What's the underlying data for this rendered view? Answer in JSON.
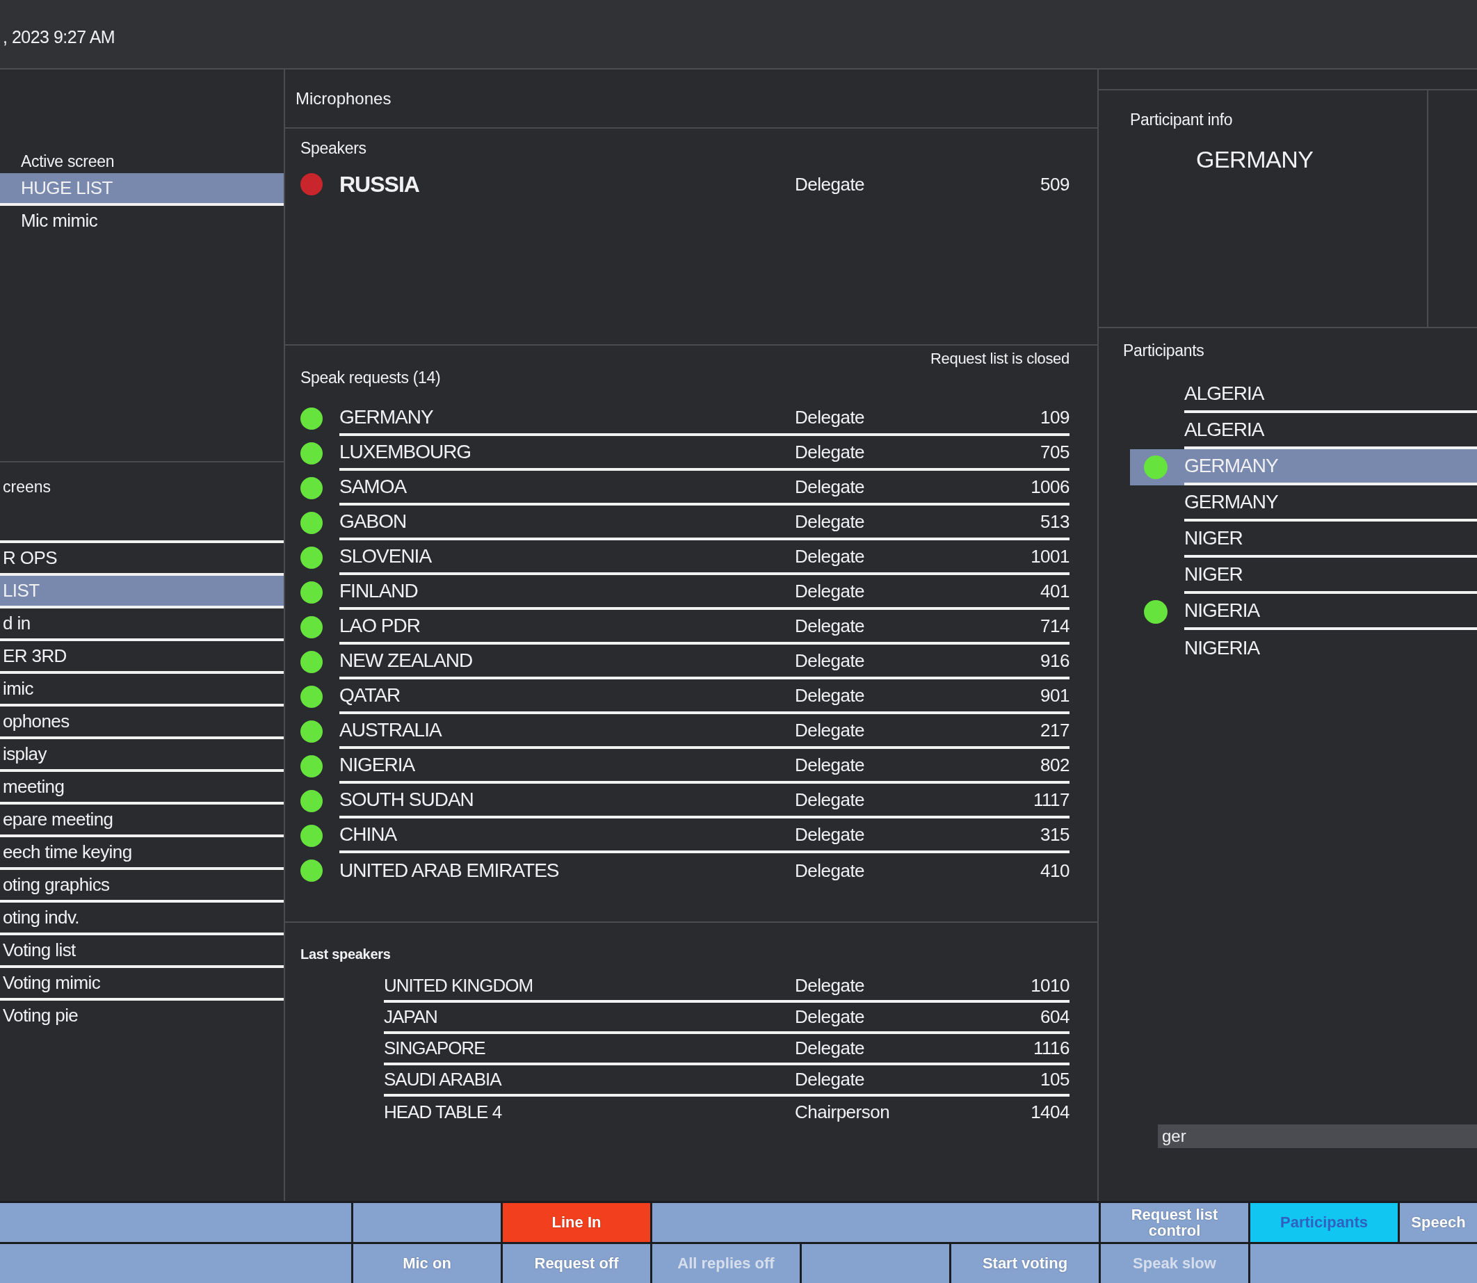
{
  "header": {
    "datetime": ", 2023 9:27 AM"
  },
  "active_screen": {
    "label": "Active screen",
    "items": [
      {
        "label": "HUGE LIST",
        "selected": true
      },
      {
        "label": "Mic mimic",
        "selected": false
      }
    ]
  },
  "screens": {
    "title": "creens",
    "items": [
      {
        "label": "R OPS",
        "selected": false
      },
      {
        "label": "LIST",
        "selected": true
      },
      {
        "label": "d in",
        "selected": false
      },
      {
        "label": "ER 3RD",
        "selected": false
      },
      {
        "label": "imic",
        "selected": false
      },
      {
        "label": "ophones",
        "selected": false
      },
      {
        "label": "isplay",
        "selected": false
      },
      {
        "label": "meeting",
        "selected": false
      },
      {
        "label": "epare meeting",
        "selected": false
      },
      {
        "label": "eech time keying",
        "selected": false
      },
      {
        "label": "oting graphics",
        "selected": false
      },
      {
        "label": "oting indv.",
        "selected": false
      },
      {
        "label": "Voting list",
        "selected": false
      },
      {
        "label": "Voting mimic",
        "selected": false
      },
      {
        "label": "Voting pie",
        "selected": false
      }
    ]
  },
  "microphones": {
    "title": "Microphones",
    "speakers": {
      "title": "Speakers",
      "rows": [
        {
          "name": "RUSSIA",
          "role": "Delegate",
          "number": "509"
        }
      ]
    },
    "speak_requests": {
      "title": "Speak requests (14)",
      "status": "Request list is closed",
      "rows": [
        {
          "name": "GERMANY",
          "role": "Delegate",
          "number": "109"
        },
        {
          "name": "LUXEMBOURG",
          "role": "Delegate",
          "number": "705"
        },
        {
          "name": "SAMOA",
          "role": "Delegate",
          "number": "1006"
        },
        {
          "name": "GABON",
          "role": "Delegate",
          "number": "513"
        },
        {
          "name": "SLOVENIA",
          "role": "Delegate",
          "number": "1001"
        },
        {
          "name": "FINLAND",
          "role": "Delegate",
          "number": "401"
        },
        {
          "name": "LAO PDR",
          "role": "Delegate",
          "number": "714"
        },
        {
          "name": "NEW ZEALAND",
          "role": "Delegate",
          "number": "916"
        },
        {
          "name": "QATAR",
          "role": "Delegate",
          "number": "901"
        },
        {
          "name": "AUSTRALIA",
          "role": "Delegate",
          "number": "217"
        },
        {
          "name": "NIGERIA",
          "role": "Delegate",
          "number": "802"
        },
        {
          "name": "SOUTH SUDAN",
          "role": "Delegate",
          "number": "1117"
        },
        {
          "name": "CHINA",
          "role": "Delegate",
          "number": "315"
        },
        {
          "name": "UNITED ARAB EMIRATES",
          "role": "Delegate",
          "number": "410"
        }
      ]
    },
    "last_speakers": {
      "title": "Last speakers",
      "rows": [
        {
          "name": "UNITED KINGDOM",
          "role": "Delegate",
          "number": "1010"
        },
        {
          "name": "JAPAN",
          "role": "Delegate",
          "number": "604"
        },
        {
          "name": "SINGAPORE",
          "role": "Delegate",
          "number": "1116"
        },
        {
          "name": "SAUDI ARABIA",
          "role": "Delegate",
          "number": "105"
        },
        {
          "name": "HEAD TABLE 4",
          "role": "Chairperson",
          "number": "1404"
        }
      ]
    }
  },
  "participant_info": {
    "title": "Participant info",
    "name": "GERMANY"
  },
  "participants": {
    "title": "Participants",
    "items": [
      {
        "name": "ALGERIA",
        "requesting": false,
        "selected": false
      },
      {
        "name": "ALGERIA",
        "requesting": false,
        "selected": false
      },
      {
        "name": "GERMANY",
        "requesting": true,
        "selected": true
      },
      {
        "name": "GERMANY",
        "requesting": false,
        "selected": false
      },
      {
        "name": "NIGER",
        "requesting": false,
        "selected": false
      },
      {
        "name": "NIGER",
        "requesting": false,
        "selected": false
      },
      {
        "name": "NIGERIA",
        "requesting": true,
        "selected": false
      },
      {
        "name": "NIGERIA",
        "requesting": false,
        "selected": false
      }
    ],
    "search": {
      "value": "ger"
    }
  },
  "bottom_bar": {
    "rows": [
      [
        "",
        "",
        {
          "label": "Line In",
          "on": true,
          "selected": false,
          "disabled": false
        },
        "",
        "",
        "",
        {
          "label": "Request list control",
          "on": false,
          "selected": false,
          "disabled": false
        },
        {
          "label": "Participants",
          "on": false,
          "selected": true,
          "disabled": false
        },
        {
          "label": "Speech",
          "on": false,
          "selected": false,
          "disabled": false
        }
      ],
      [
        "",
        {
          "label": "Mic on",
          "on": false,
          "selected": false,
          "disabled": false
        },
        {
          "label": "Request off",
          "on": false,
          "selected": false,
          "disabled": false
        },
        {
          "label": "All replies off",
          "on": false,
          "selected": false,
          "disabled": true
        },
        "",
        {
          "label": "Start voting",
          "on": false,
          "selected": false,
          "disabled": false
        },
        {
          "label": "Speak slow",
          "on": false,
          "selected": false,
          "disabled": true
        },
        "",
        ""
      ]
    ]
  }
}
